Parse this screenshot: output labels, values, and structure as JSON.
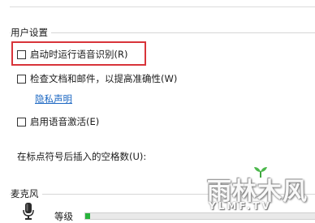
{
  "user_settings": {
    "section_label": "用户设置",
    "options": [
      {
        "label": "启动时运行语音识别(R)",
        "checked": false,
        "highlighted": true
      },
      {
        "label": "检查文档和邮件，以提高准确性(W)",
        "checked": false,
        "highlighted": false
      },
      {
        "label": "启用语音激活(E)",
        "checked": false,
        "highlighted": false
      }
    ],
    "privacy_link": "隐私声明",
    "spaces_label": "在标点符号后插入的空格数(U):"
  },
  "microphone": {
    "section_label": "麦克风",
    "level_label": "等级",
    "level_fraction": 0.02
  },
  "watermark": {
    "text_cn": "雨林木风",
    "text_en": "YLMF.TV"
  },
  "colors": {
    "highlight": "#d8343a",
    "link": "#1a66c2",
    "meter_fill": "#27b33b"
  }
}
